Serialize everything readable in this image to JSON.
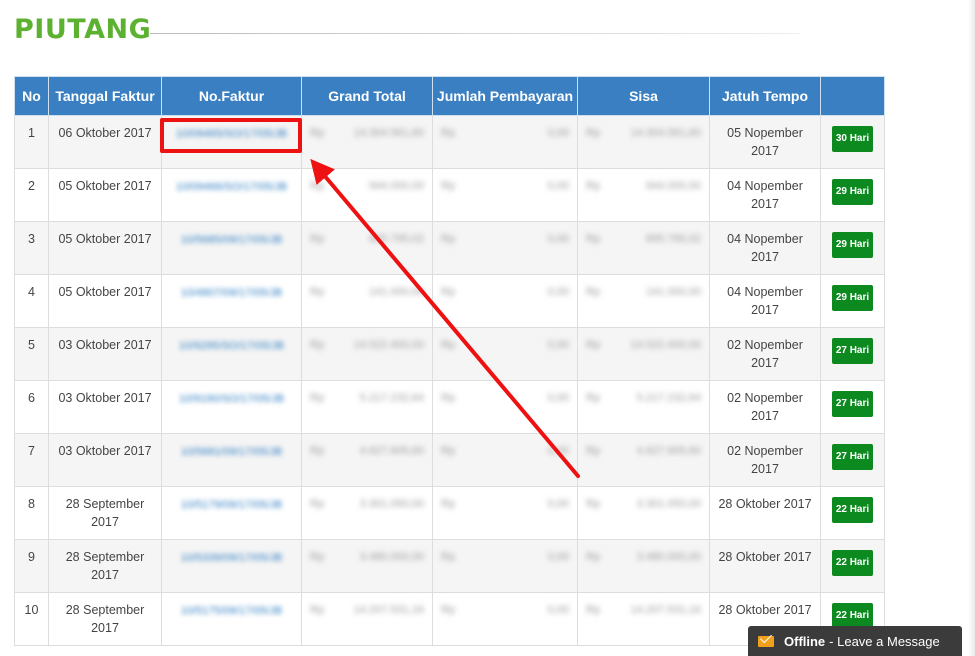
{
  "page": {
    "title": "PIUTANG"
  },
  "table": {
    "headers": [
      "No",
      "Tanggal Faktur",
      "No.Faktur",
      "Grand Total",
      "Jumlah Pembayaran",
      "Sisa",
      "Jatuh Tempo",
      ""
    ],
    "rows": [
      {
        "no": "1",
        "tanggal": "06 Oktober 2017",
        "faktur": "10/09465/SO/17/05/JB",
        "cur1": "Rp",
        "grand_total": "14.304.561,60",
        "cur2": "Rp",
        "bayar": "0,00",
        "cur3": "Rp",
        "sisa": "14.304.561,60",
        "jatuh_tempo": "05 Nopember 2017",
        "badge": "30 Hari"
      },
      {
        "no": "2",
        "tanggal": "05 Oktober 2017",
        "faktur": "10/09466/SO/17/05/JB",
        "cur1": "Rp",
        "grand_total": "944.000,00",
        "cur2": "Rp",
        "bayar": "0,00",
        "cur3": "Rp",
        "sisa": "944.000,00",
        "jatuh_tempo": "04 Nopember 2017",
        "badge": "29 Hari"
      },
      {
        "no": "3",
        "tanggal": "05 Oktober 2017",
        "faktur": "10/5685/09/17/05/JB",
        "cur1": "Rp",
        "grand_total": "655.795,02",
        "cur2": "Rp",
        "bayar": "0,00",
        "cur3": "Rp",
        "sisa": "655.795,02",
        "jatuh_tempo": "04 Nopember 2017",
        "badge": "29 Hari"
      },
      {
        "no": "4",
        "tanggal": "05 Oktober 2017",
        "faktur": "10/4807/09/17/05/JB",
        "cur1": "Rp",
        "grand_total": "141.000,00",
        "cur2": "Rp",
        "bayar": "0,00",
        "cur3": "Rp",
        "sisa": "141.000,00",
        "jatuh_tempo": "04 Nopember 2017",
        "badge": "29 Hari"
      },
      {
        "no": "5",
        "tanggal": "03 Oktober 2017",
        "faktur": "10/9295/SO/17/05/JB",
        "cur1": "Rp",
        "grand_total": "14.522.400,00",
        "cur2": "Rp",
        "bayar": "0,00",
        "cur3": "Rp",
        "sisa": "14.522.400,00",
        "jatuh_tempo": "02 Nopember 2017",
        "badge": "27 Hari"
      },
      {
        "no": "6",
        "tanggal": "03 Oktober 2017",
        "faktur": "10/9190/SO/17/05/JB",
        "cur1": "Rp",
        "grand_total": "5.217.232,64",
        "cur2": "Rp",
        "bayar": "0,00",
        "cur3": "Rp",
        "sisa": "5.217.232,64",
        "jatuh_tempo": "02 Nopember 2017",
        "badge": "27 Hari"
      },
      {
        "no": "7",
        "tanggal": "03 Oktober 2017",
        "faktur": "10/5681/09/17/05/JB",
        "cur1": "Rp",
        "grand_total": "4.627.605,60",
        "cur2": "Rp",
        "bayar": "0,00",
        "cur3": "Rp",
        "sisa": "4.627.605,60",
        "jatuh_tempo": "02 Nopember 2017",
        "badge": "27 Hari"
      },
      {
        "no": "8",
        "tanggal": "28 September 2017",
        "faktur": "10/5179/09/17/05/JB",
        "cur1": "Rp",
        "grand_total": "3.301.050,00",
        "cur2": "Rp",
        "bayar": "0,00",
        "cur3": "Rp",
        "sisa": "3.301.050,00",
        "jatuh_tempo": "28 Oktober 2017",
        "badge": "22 Hari"
      },
      {
        "no": "9",
        "tanggal": "28 September 2017",
        "faktur": "10/5339/09/17/05/JB",
        "cur1": "Rp",
        "grand_total": "3.480.000,00",
        "cur2": "Rp",
        "bayar": "0,00",
        "cur3": "Rp",
        "sisa": "3.480.000,00",
        "jatuh_tempo": "28 Oktober 2017",
        "badge": "22 Hari"
      },
      {
        "no": "10",
        "tanggal": "28 September 2017",
        "faktur": "10/5175/09/17/05/JB",
        "cur1": "Rp",
        "grand_total": "14.207.531,16",
        "cur2": "Rp",
        "bayar": "0,00",
        "cur3": "Rp",
        "sisa": "14.207.531,16",
        "jatuh_tempo": "28 Oktober 2017",
        "badge": "22 Hari"
      }
    ]
  },
  "chat": {
    "status": "Offline",
    "message": "- Leave a Message",
    "icon": "mail-icon"
  },
  "colors": {
    "title": "#5cb230",
    "header_bg": "#3a7fc2",
    "badge_bg": "#0d8a1f",
    "annotation": "#ee1111",
    "link": "#2f7ec2"
  }
}
